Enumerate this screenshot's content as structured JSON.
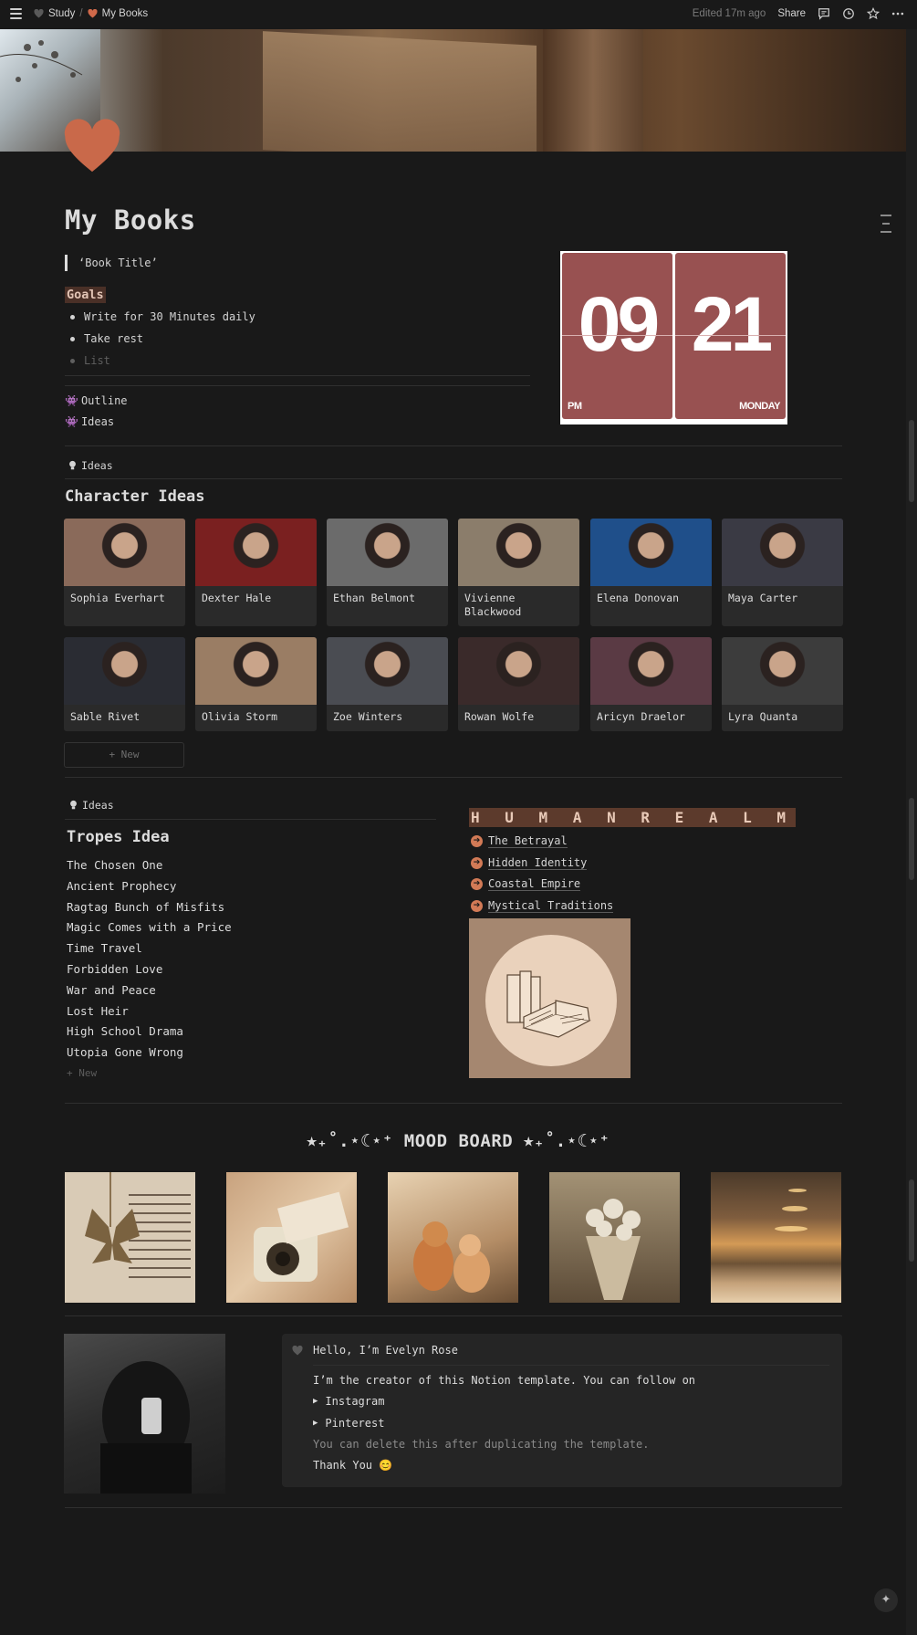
{
  "topbar": {
    "breadcrumb": [
      {
        "label": "Study",
        "icon": "black-heart-icon"
      },
      {
        "label": "My Books",
        "icon": "orange-heart-icon"
      }
    ],
    "separator": "/",
    "edited": "Edited 17m ago",
    "share": "Share",
    "icons": [
      "comments-icon",
      "history-icon",
      "favorite-star-icon",
      "more-icon"
    ]
  },
  "page": {
    "title": "My Books",
    "icon": "heart-icon",
    "icon_color": "#c9694a",
    "quote": "‘Book Title’",
    "goals_heading": "Goals",
    "goals": [
      "Write for 30 Minutes daily",
      "Take rest"
    ],
    "goals_placeholder": "List",
    "links": [
      {
        "label": "Outline",
        "icon": "invader-icon"
      },
      {
        "label": "Ideas",
        "icon": "invader-icon"
      }
    ]
  },
  "clock": {
    "hour": "09",
    "minute": "21",
    "ampm": "PM",
    "day": "MONDAY",
    "color": "#985151"
  },
  "character_section": {
    "tag": "Ideas",
    "heading": "Character Ideas",
    "cards": [
      {
        "name": "Sophia Everhart"
      },
      {
        "name": "Dexter Hale"
      },
      {
        "name": "Ethan Belmont"
      },
      {
        "name": "Vivienne Blackwood"
      },
      {
        "name": "Elena Donovan"
      },
      {
        "name": "Maya Carter"
      },
      {
        "name": "Sable Rivet"
      },
      {
        "name": "Olivia Storm"
      },
      {
        "name": "Zoe Winters"
      },
      {
        "name": "Rowan Wolfe"
      },
      {
        "name": "Aricyn Draelor"
      },
      {
        "name": "Lyra Quanta"
      }
    ],
    "new_label": "+ New"
  },
  "tropes": {
    "tag": "Ideas",
    "heading": "Tropes Idea",
    "items": [
      "The Chosen One",
      "Ancient Prophecy",
      "Ragtag Bunch of Misfits",
      "Magic Comes with a Price",
      "Time Travel",
      "Forbidden Love",
      "War and Peace",
      "Lost Heir",
      "High School Drama",
      "Utopia Gone Wrong"
    ],
    "new_label": "+ New"
  },
  "realm": {
    "title": "H U M A N   R E A L M",
    "links": [
      "The Betrayal",
      "Hidden Identity",
      "Coastal Empire",
      "Mystical Traditions"
    ]
  },
  "mood_board": {
    "title": "⭑₊˚.⋆☾⋆⁺ MOOD BOARD ⭑₊˚.⋆☾⋆⁺"
  },
  "callout": {
    "title": "Hello, I’m Evelyn Rose",
    "line1": "I’m the creator of this Notion template. You can follow on",
    "toggles": [
      "Instagram",
      "Pinterest"
    ],
    "note": "You can delete this after duplicating the template.",
    "thanks": "Thank You 😊"
  }
}
